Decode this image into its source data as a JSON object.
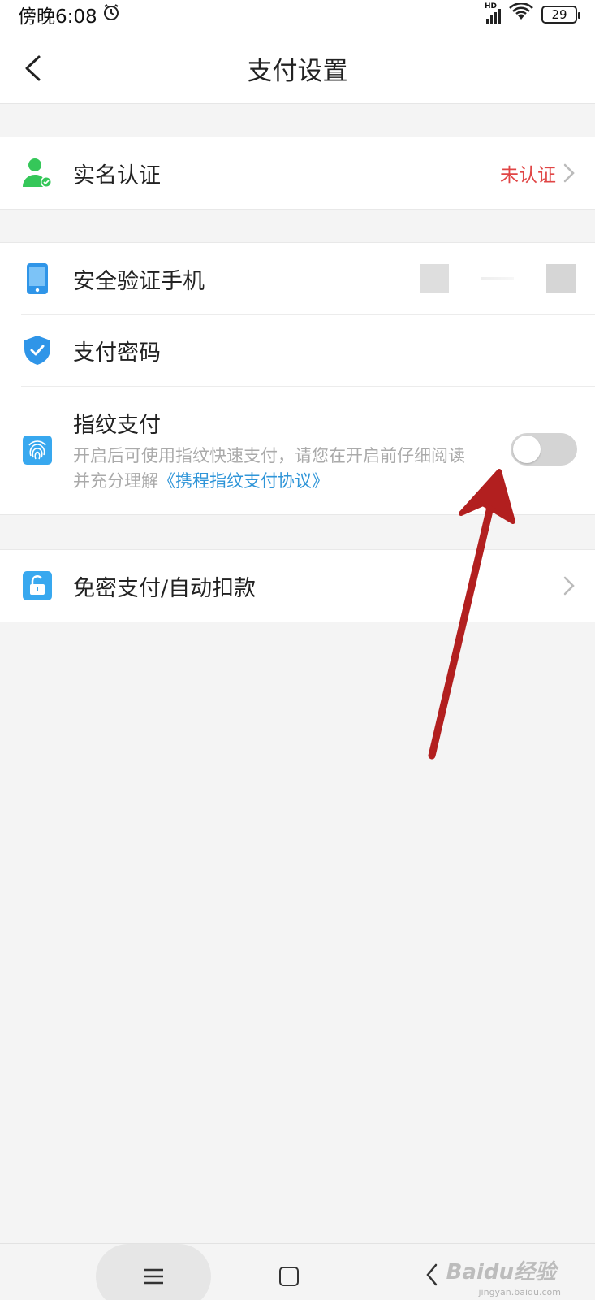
{
  "status_bar": {
    "time": "傍晚6:08",
    "network": "HD",
    "battery": "29"
  },
  "header": {
    "title": "支付设置"
  },
  "sections": {
    "identity": {
      "label": "实名认证",
      "status": "未认证"
    },
    "security": {
      "phone_label": "安全验证手机",
      "password_label": "支付密码",
      "fingerprint": {
        "title": "指纹支付",
        "desc_prefix": "开启后可使用指纹快速支付，请您在开启前仔细阅读并充分理解",
        "link": "《携程指纹支付协议》",
        "enabled": false
      }
    },
    "autopay": {
      "label": "免密支付/自动扣款"
    }
  },
  "watermark": {
    "text": "Baidu经验",
    "sub": "jingyan.baidu.com"
  },
  "colors": {
    "unverified": "#e04545",
    "link": "#2f95d8",
    "annotation_arrow": "#b21f1f"
  }
}
